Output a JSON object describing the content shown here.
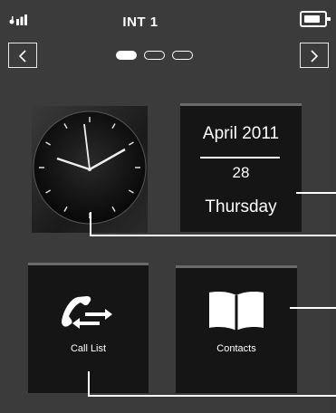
{
  "header": {
    "title": "INT 1",
    "signal_icon": "signal-icon",
    "battery_icon": "battery-icon",
    "prev_label": "<",
    "next_label": ">",
    "pages": [
      {
        "active": true
      },
      {
        "active": false
      },
      {
        "active": false
      }
    ]
  },
  "tiles": {
    "clock": {
      "icon": "analog-clock-icon"
    },
    "date": {
      "month_year": "April 2011",
      "day": "28",
      "weekday": "Thursday"
    },
    "call_list": {
      "label": "Call List",
      "icon": "phone-arrows-icon"
    },
    "contacts": {
      "label": "Contacts",
      "icon": "book-icon"
    }
  },
  "colors": {
    "background": "#3b3b3b",
    "tile": "#151515",
    "text": "#ffffff"
  }
}
